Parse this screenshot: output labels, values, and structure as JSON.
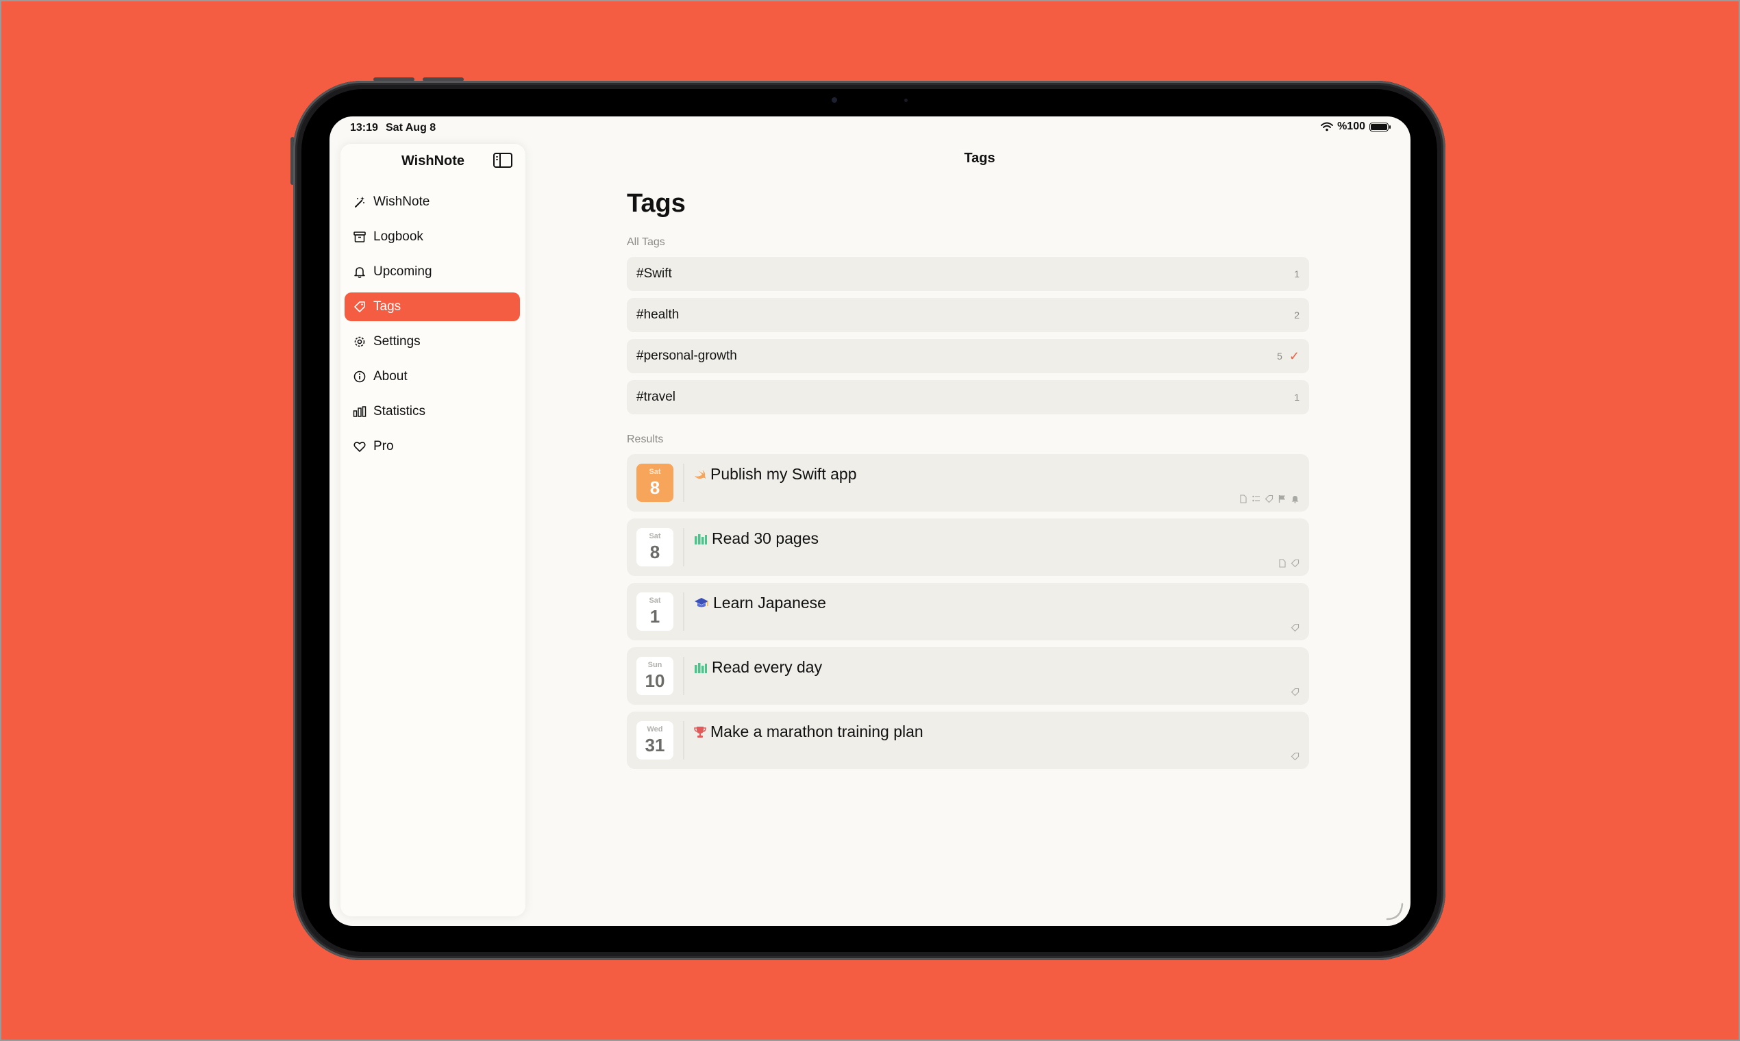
{
  "status_bar": {
    "time": "13:19",
    "date": "Sat Aug 8",
    "battery": "%100"
  },
  "sidebar": {
    "title": "WishNote",
    "items": [
      {
        "label": "WishNote",
        "icon": "magic-wand-icon",
        "active": false
      },
      {
        "label": "Logbook",
        "icon": "archive-box-icon",
        "active": false
      },
      {
        "label": "Upcoming",
        "icon": "bell-icon",
        "active": false
      },
      {
        "label": "Tags",
        "icon": "tag-icon",
        "active": true
      },
      {
        "label": "Settings",
        "icon": "gear-icon",
        "active": false
      },
      {
        "label": "About",
        "icon": "info-icon",
        "active": false
      },
      {
        "label": "Statistics",
        "icon": "bar-chart-icon",
        "active": false
      },
      {
        "label": "Pro",
        "icon": "heart-icon",
        "active": false
      }
    ]
  },
  "header": {
    "title": "Tags"
  },
  "main": {
    "title": "Tags",
    "all_tags_label": "All Tags",
    "tags": [
      {
        "name": "#Swift",
        "count": "1",
        "selected": false
      },
      {
        "name": "#health",
        "count": "2",
        "selected": false
      },
      {
        "name": "#personal-growth",
        "count": "5",
        "selected": true
      },
      {
        "name": "#travel",
        "count": "1",
        "selected": false
      }
    ],
    "results_label": "Results",
    "results": [
      {
        "dow": "Sat",
        "day": "8",
        "emoji": "🕊",
        "title": "Publish my Swift app",
        "today": true,
        "icons": [
          "note-icon",
          "checklist-icon",
          "tag-icon",
          "flag-icon",
          "bell-icon"
        ]
      },
      {
        "dow": "Sat",
        "day": "8",
        "emoji": "📊",
        "title": "Read 30 pages",
        "today": false,
        "icons": [
          "note-icon",
          "tag-icon"
        ]
      },
      {
        "dow": "Sat",
        "day": "1",
        "emoji": "🎓",
        "title": "Learn Japanese",
        "today": false,
        "icons": [
          "tag-icon"
        ]
      },
      {
        "dow": "Sun",
        "day": "10",
        "emoji": "📊",
        "title": "Read every day",
        "today": false,
        "icons": [
          "tag-icon"
        ]
      },
      {
        "dow": "Wed",
        "day": "31",
        "emoji": "🏆",
        "title": "Make a marathon training plan",
        "today": false,
        "icons": [
          "tag-icon"
        ]
      }
    ]
  },
  "colors": {
    "accent": "#F55D42",
    "today": "#F7A55A",
    "row_bg": "#EFEEE9",
    "background": "#FAF9F5"
  }
}
